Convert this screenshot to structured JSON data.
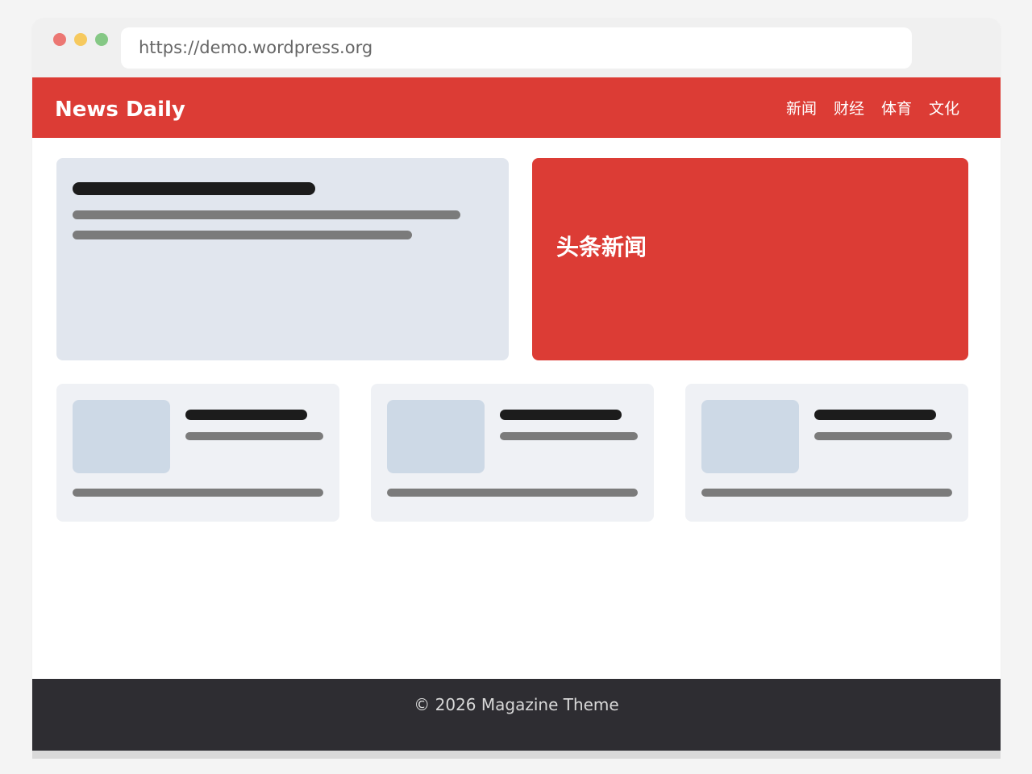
{
  "browser": {
    "url": "https://demo.wordpress.org",
    "window_controls": [
      "close",
      "minimize",
      "maximize"
    ]
  },
  "header": {
    "site_title": "News Daily",
    "nav": [
      {
        "label": "新闻"
      },
      {
        "label": "财经"
      },
      {
        "label": "体育"
      },
      {
        "label": "文化"
      }
    ]
  },
  "main": {
    "featured": {
      "label": "头条新闻"
    },
    "cards_count": 3
  },
  "footer": {
    "text": "© 2026 Magazine Theme"
  },
  "colors": {
    "brand_red": "#dc3c35",
    "dot_red": "#ec7773",
    "dot_yellow": "#f6c95e",
    "dot_green": "#85c885",
    "placeholder_bg": "#e1e6ee",
    "card_bg": "#eff1f5",
    "thumb_bg": "#cdd9e6",
    "bar_dark": "#1c1c1c",
    "bar_mid": "#7b7b7b",
    "footer_bg": "#2e2d32"
  }
}
